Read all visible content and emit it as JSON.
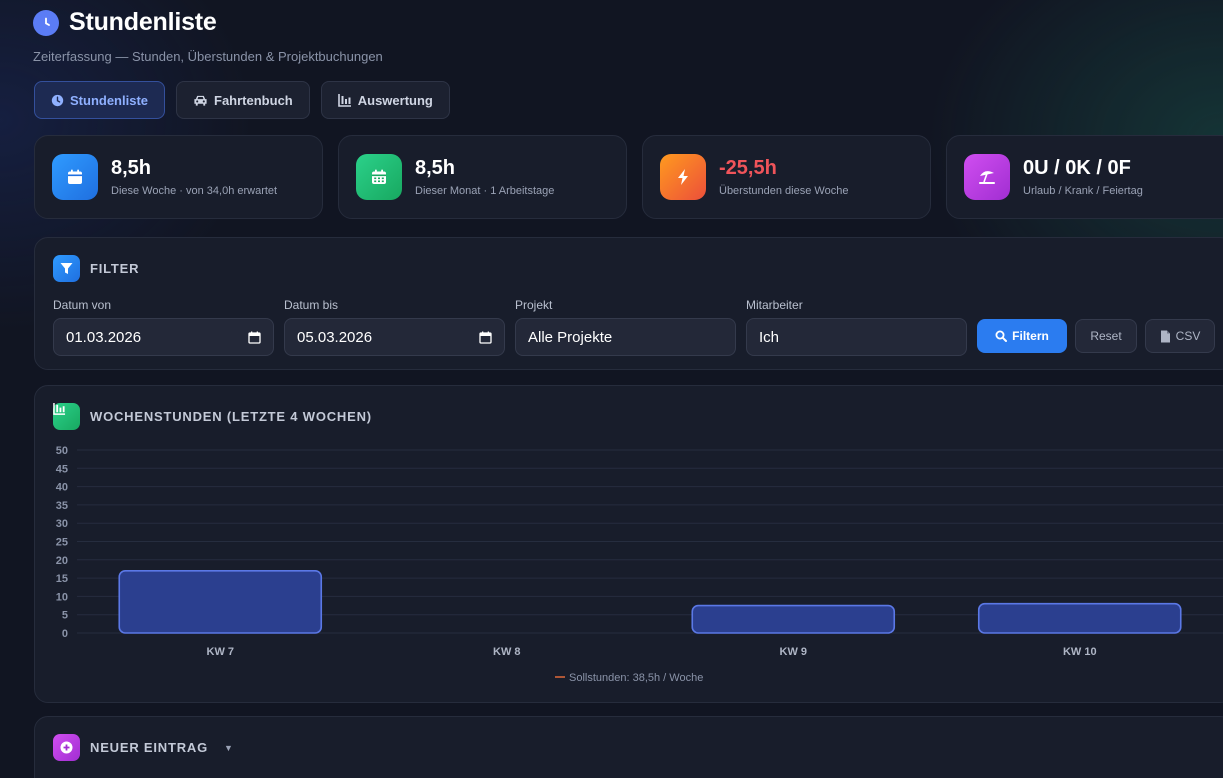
{
  "header": {
    "title": "Stundenliste",
    "subtitle": "Zeiterfassung — Stunden, Überstunden & Projektbuchungen"
  },
  "tabs": [
    {
      "label": "Stundenliste",
      "icon": "clock-icon",
      "active": true
    },
    {
      "label": "Fahrtenbuch",
      "icon": "car-icon",
      "active": false
    },
    {
      "label": "Auswertung",
      "icon": "chart-icon",
      "active": false
    }
  ],
  "stats": [
    {
      "value": "8,5h",
      "label": "Diese Woche · von 34,0h erwartet",
      "icon": "calendar-week-icon",
      "color": "#2196f3"
    },
    {
      "value": "8,5h",
      "label": "Dieser Monat · 1 Arbeitstage",
      "icon": "calendar-month-icon",
      "color": "#22c177"
    },
    {
      "value": "-25,5h",
      "label": "Überstunden diese Woche",
      "icon": "bolt-icon",
      "color": "#f2712a"
    },
    {
      "value": "0U / 0K / 0F",
      "label": "Urlaub / Krank / Feiertag",
      "icon": "umbrella-beach-icon",
      "color": "#c13ee0"
    }
  ],
  "filter": {
    "title": "FILTER",
    "date_from_label": "Datum von",
    "date_from_value": "01.03.2026",
    "date_to_label": "Datum bis",
    "date_to_value": "05.03.2026",
    "project_label": "Projekt",
    "project_value": "Alle Projekte",
    "employee_label": "Mitarbeiter",
    "employee_value": "Ich",
    "filter_button": "Filtern",
    "reset_button": "Reset",
    "csv_button": "CSV"
  },
  "chart_panel": {
    "title": "WOCHENSTUNDEN (LETZTE 4 WOCHEN)"
  },
  "chart_data": {
    "type": "bar",
    "categories": [
      "KW 7",
      "KW 8",
      "KW 9",
      "KW 10"
    ],
    "values": [
      17,
      0,
      7.5,
      8
    ],
    "ylim": [
      0,
      50
    ],
    "yticks": [
      "0",
      "5",
      "10",
      "15",
      "20",
      "25",
      "30",
      "35",
      "40",
      "45",
      "50"
    ],
    "legend": "Sollstunden: 38,5h / Woche",
    "target": 38.5,
    "grid": true,
    "bar_color": "#2b3f8f",
    "bar_border": "#5b78e6"
  },
  "new_entry": {
    "title": "NEUER EINTRAG"
  }
}
